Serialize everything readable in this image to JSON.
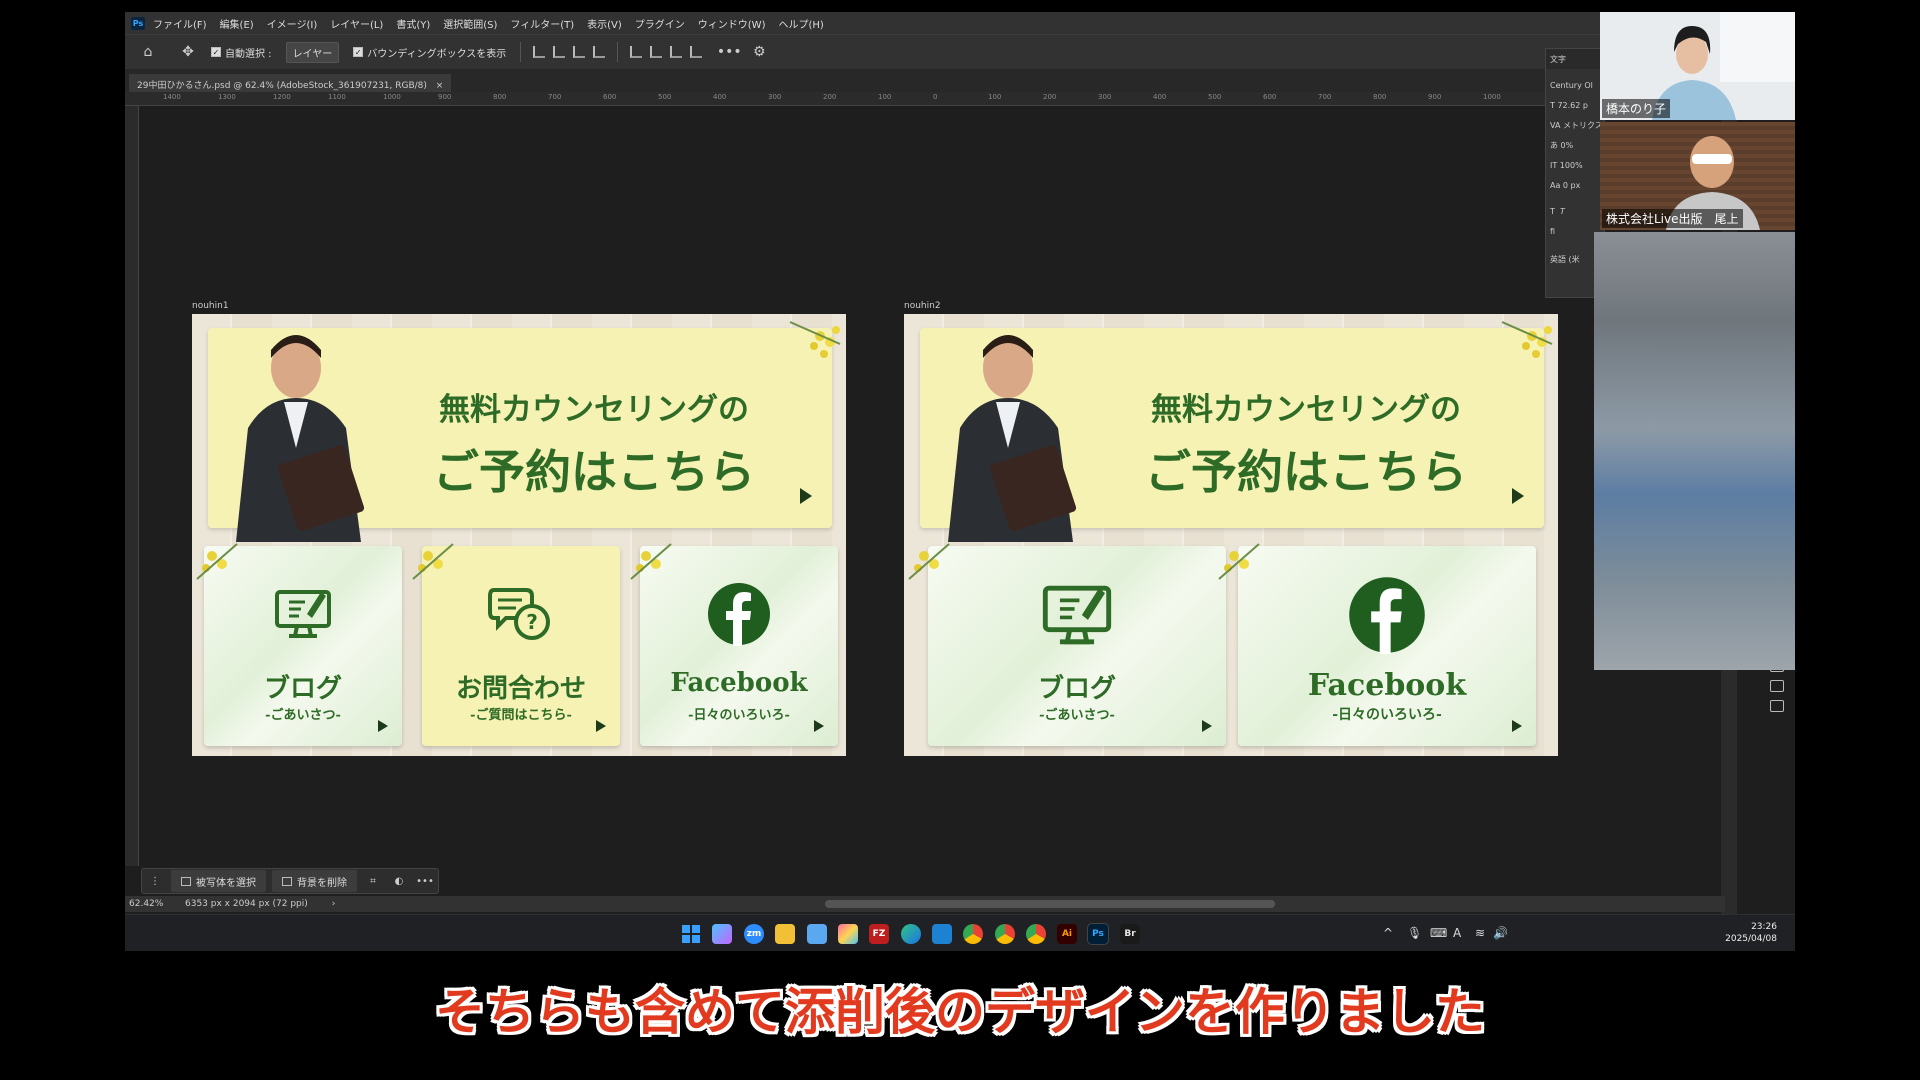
{
  "menubar": {
    "items": [
      "ファイル(F)",
      "編集(E)",
      "イメージ(I)",
      "レイヤー(L)",
      "書式(Y)",
      "選択範囲(S)",
      "フィルター(T)",
      "表示(V)",
      "プラグイン",
      "ウィンドウ(W)",
      "ヘルプ(H)"
    ]
  },
  "options": {
    "auto_select_label": "自動選択 :",
    "auto_select_value": "レイヤー",
    "bounding_box_label": "バウンディングボックスを表示"
  },
  "document": {
    "tab_title": "29中田ひかるさん.psd @ 62.4% (AdobeStock_361907231, RGB/8)",
    "tab_close": "×"
  },
  "rulers": {
    "h_ticks": [
      "1400",
      "1300",
      "1200",
      "1100",
      "1000",
      "900",
      "800",
      "700",
      "600",
      "500",
      "400",
      "300",
      "200",
      "100",
      "0",
      "100",
      "200",
      "300",
      "400",
      "500",
      "600",
      "700",
      "800",
      "900",
      "1000"
    ]
  },
  "artboards": [
    {
      "label": "nouhin1",
      "hero_line1": "無料カウンセリングの",
      "hero_line2": "ご予約はこちら",
      "cards": [
        {
          "title": "ブログ",
          "subtitle": "-ごあいさつ-",
          "icon": "computer-icon"
        },
        {
          "title": "お問合わせ",
          "subtitle": "-ご質問はこちら-",
          "icon": "chat-question-icon"
        },
        {
          "title": "Facebook",
          "subtitle": "-日々のいろいろ-",
          "icon": "facebook-icon"
        }
      ]
    },
    {
      "label": "nouhin2",
      "hero_line1": "無料カウンセリングの",
      "hero_line2": "ご予約はこちら",
      "cards": [
        {
          "title": "ブログ",
          "subtitle": "-ごあいさつ-",
          "icon": "computer-icon"
        },
        {
          "title": "Facebook",
          "subtitle": "-日々のいろいろ-",
          "icon": "facebook-icon"
        }
      ]
    }
  ],
  "char_panel": {
    "title": "文字",
    "font": "Century Ol",
    "size": "72.62 p",
    "kerning": "メトリクス",
    "tracking": "0%",
    "vscale": "100%",
    "baseline": "0 px",
    "lang": "英語 (米"
  },
  "context_bar": {
    "select_subject": "被写体を選択",
    "remove_bg": "背景を削除"
  },
  "status": {
    "zoom": "62.42%",
    "doc_size": "6353 px x 2094 px (72 ppi)"
  },
  "taskbar": {
    "time": "23:26",
    "date": "2025/04/08",
    "apps": [
      "windows",
      "copilot",
      "zoom",
      "explorer",
      "notepad",
      "photos",
      "filezilla",
      "edge",
      "vscode",
      "chrome",
      "chrome",
      "chrome",
      "illustrator",
      "photoshop",
      "bridge"
    ],
    "labels": {
      "zoom": "zm",
      "filezilla": "FZ",
      "illustrator": "Ai",
      "photoshop": "Ps",
      "bridge": "Br"
    }
  },
  "zoom_participants": [
    {
      "name": "橋本のり子"
    },
    {
      "name": "株式会社Live出版　尾上"
    }
  ],
  "caption": "そちらも含めて添削後のデザインを作りました",
  "colors": {
    "brand_green": "#2e6b26",
    "hero_yellow": "#f5f2b4",
    "caption_red": "#e23a1f",
    "ps_dark": "#1e1e1e"
  }
}
